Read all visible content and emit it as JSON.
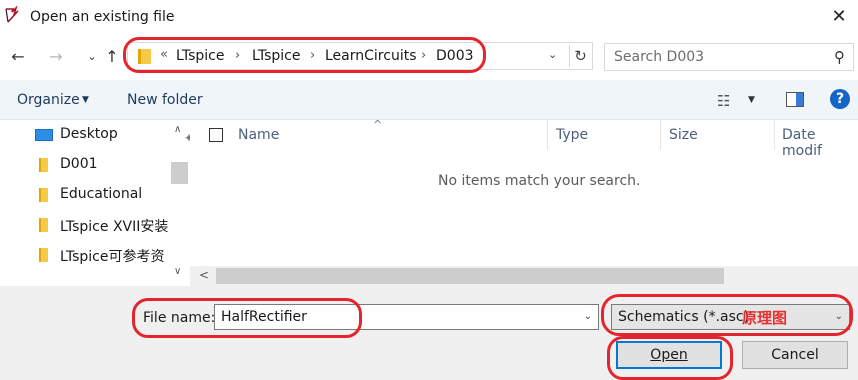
{
  "window": {
    "title": "Open an existing file",
    "close_glyph": "✕",
    "app_icon": "ltspice-probe-icon"
  },
  "nav": {
    "back_glyph": "←",
    "forward_glyph": "→",
    "recent_glyph": "⌄",
    "up_glyph": "↑"
  },
  "address": {
    "overflow_glyph": "«",
    "crumbs": [
      "LTspice",
      "LTspice",
      "LearnCircuits",
      "D003"
    ],
    "separator": "›",
    "dropdown_glyph": "⌄",
    "refresh_glyph": "↻"
  },
  "search": {
    "placeholder": "Search D003",
    "icon_glyph": "⚲"
  },
  "toolbar": {
    "organize_label": "Organize",
    "new_folder_label": "New folder",
    "caret_glyph": "▼",
    "view_glyph": "☷",
    "help_glyph": "?"
  },
  "sidebar": {
    "items": [
      {
        "label": "Desktop",
        "icon": "desktop-icon"
      },
      {
        "label": "D001",
        "icon": "folder-icon"
      },
      {
        "label": "Educational",
        "icon": "folder-icon"
      },
      {
        "label": "LTspice XVII安装",
        "icon": "folder-icon"
      },
      {
        "label": "LTspice可参考资",
        "icon": "folder-icon"
      }
    ],
    "pin_glyph": "📌",
    "scroll_up_glyph": "∧",
    "scroll_down_glyph": "∨"
  },
  "filelist": {
    "columns": [
      "Name",
      "Type",
      "Size",
      "Date modif"
    ],
    "sort_glyph": "^",
    "empty_message": "No items match your search.",
    "scroll_left_glyph": "<"
  },
  "bottom": {
    "file_name_label": "File name:",
    "file_name_value": "HalfRectifier",
    "file_type_value": "Schematics (*.asc)",
    "annotation": "原理图",
    "open_label": "Open",
    "cancel_label": "Cancel",
    "caret_glyph": "⌄"
  },
  "colors": {
    "annotation_red": "#e3262d",
    "accent_blue": "#0078d7",
    "toolbar_bg": "#f0f5fa"
  }
}
